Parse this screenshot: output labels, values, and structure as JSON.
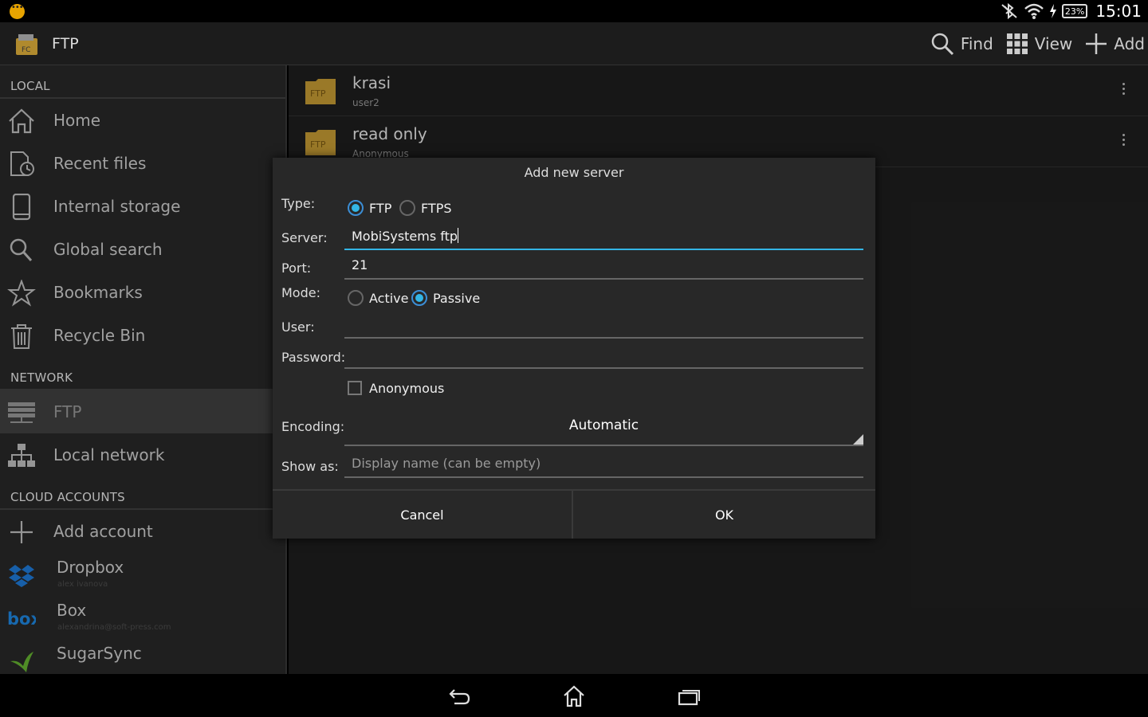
{
  "status_bar": {
    "time": "15:01",
    "battery": "23%"
  },
  "action_bar": {
    "title": "FTP",
    "actions": {
      "find": "Find",
      "view": "View",
      "add": "Add"
    }
  },
  "sidebar": {
    "sections": {
      "local": "LOCAL",
      "network": "NETWORK",
      "cloud": "CLOUD ACCOUNTS"
    },
    "local_items": [
      "Home",
      "Recent files",
      "Internal storage",
      "Global search",
      "Bookmarks",
      "Recycle Bin"
    ],
    "network_items": [
      "FTP",
      "Local network"
    ],
    "cloud_add": "Add account",
    "cloud_items": [
      {
        "name": "Dropbox",
        "account": "alex ivanova"
      },
      {
        "name": "Box",
        "account": "alexandrina@soft-press.com"
      },
      {
        "name": "SugarSync",
        "account": ""
      }
    ]
  },
  "content": {
    "items": [
      {
        "icon_text": "FTP",
        "name": "krasi",
        "user": "user2"
      },
      {
        "icon_text": "FTP",
        "name": "read only",
        "user": "Anonymous"
      }
    ]
  },
  "dialog": {
    "title": "Add new server",
    "labels": {
      "type": "Type:",
      "server": "Server:",
      "port": "Port:",
      "mode": "Mode:",
      "user": "User:",
      "password": "Password:",
      "encoding": "Encoding:",
      "show_as": "Show as:"
    },
    "type_options": {
      "ftp": "FTP",
      "ftps": "FTPS",
      "selected": "FTP"
    },
    "server_value": "MobiSystems ftp",
    "port_value": "21",
    "mode_options": {
      "active": "Active",
      "passive": "Passive",
      "selected": "Passive"
    },
    "user_value": "",
    "password_value": "",
    "anonymous_label": "Anonymous",
    "anonymous_checked": false,
    "encoding_value": "Automatic",
    "show_as_placeholder": "Display name (can be empty)",
    "buttons": {
      "cancel": "Cancel",
      "ok": "OK"
    }
  },
  "colors": {
    "accent": "#33b5e5",
    "folder": "#b08a2e"
  }
}
